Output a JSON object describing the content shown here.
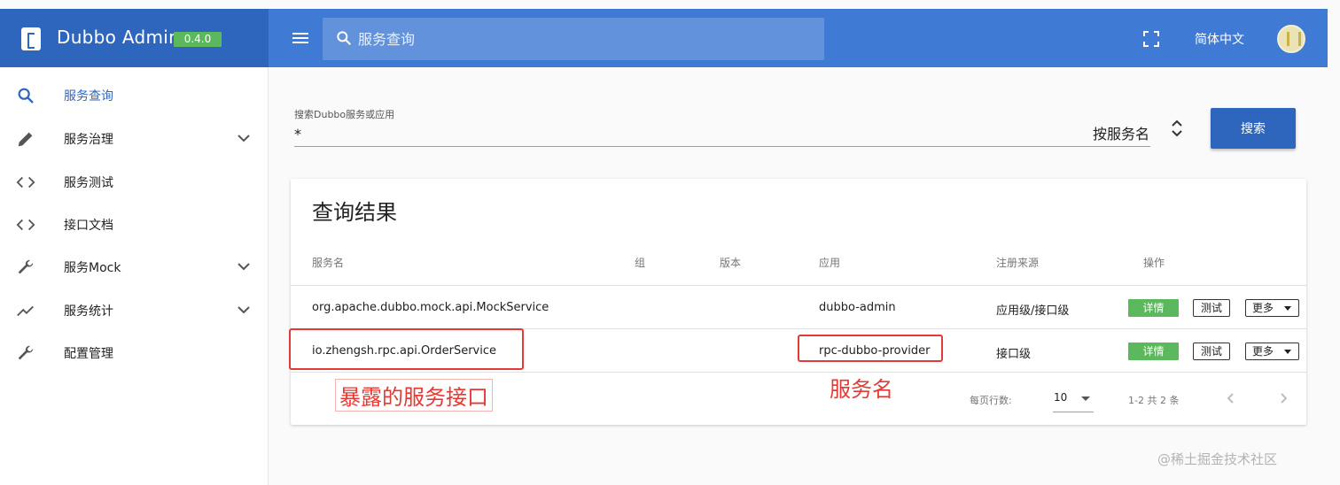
{
  "header": {
    "brand_name": "Dubbo Admin",
    "version": "0.4.0",
    "search_placeholder": "服务查询",
    "language": "简体中文"
  },
  "sidebar": {
    "items": [
      {
        "label": "服务查询",
        "icon": "search-icon",
        "expandable": false,
        "active": true
      },
      {
        "label": "服务治理",
        "icon": "pencil-icon",
        "expandable": true
      },
      {
        "label": "服务测试",
        "icon": "code-icon",
        "expandable": false
      },
      {
        "label": "接口文档",
        "icon": "code-icon",
        "expandable": false
      },
      {
        "label": "服务Mock",
        "icon": "wrench-icon",
        "expandable": true
      },
      {
        "label": "服务统计",
        "icon": "trending-icon",
        "expandable": true
      },
      {
        "label": "配置管理",
        "icon": "wrench-icon",
        "expandable": false
      }
    ]
  },
  "search": {
    "label": "搜索Dubbo服务或应用",
    "value": "*",
    "type": "按服务名",
    "button": "搜索"
  },
  "results": {
    "title": "查询结果",
    "columns": [
      "服务名",
      "组",
      "版本",
      "应用",
      "注册来源",
      "操作"
    ],
    "rows": [
      {
        "service": "org.apache.dubbo.mock.api.MockService",
        "group": "",
        "version": "",
        "app": "dubbo-admin",
        "source": "应用级/接口级"
      },
      {
        "service": "io.zhengsh.rpc.api.OrderService",
        "group": "",
        "version": "",
        "app": "rpc-dubbo-provider",
        "source": "接口级"
      }
    ],
    "actions": {
      "detail": "详情",
      "test": "测试",
      "more": "更多"
    },
    "footer": {
      "rows_per_page_label": "每页行数:",
      "rows_per_page": "10",
      "range": "1-2 共 2 条"
    }
  },
  "annotations": {
    "service_interface": "暴露的服务接口",
    "service_name": "服务名"
  },
  "watermark": "@稀土掘金技术社区",
  "colors": {
    "brand": "#2f66bd",
    "header": "#3f7bd4",
    "success": "#5cb85c",
    "annotation": "#e53935"
  }
}
